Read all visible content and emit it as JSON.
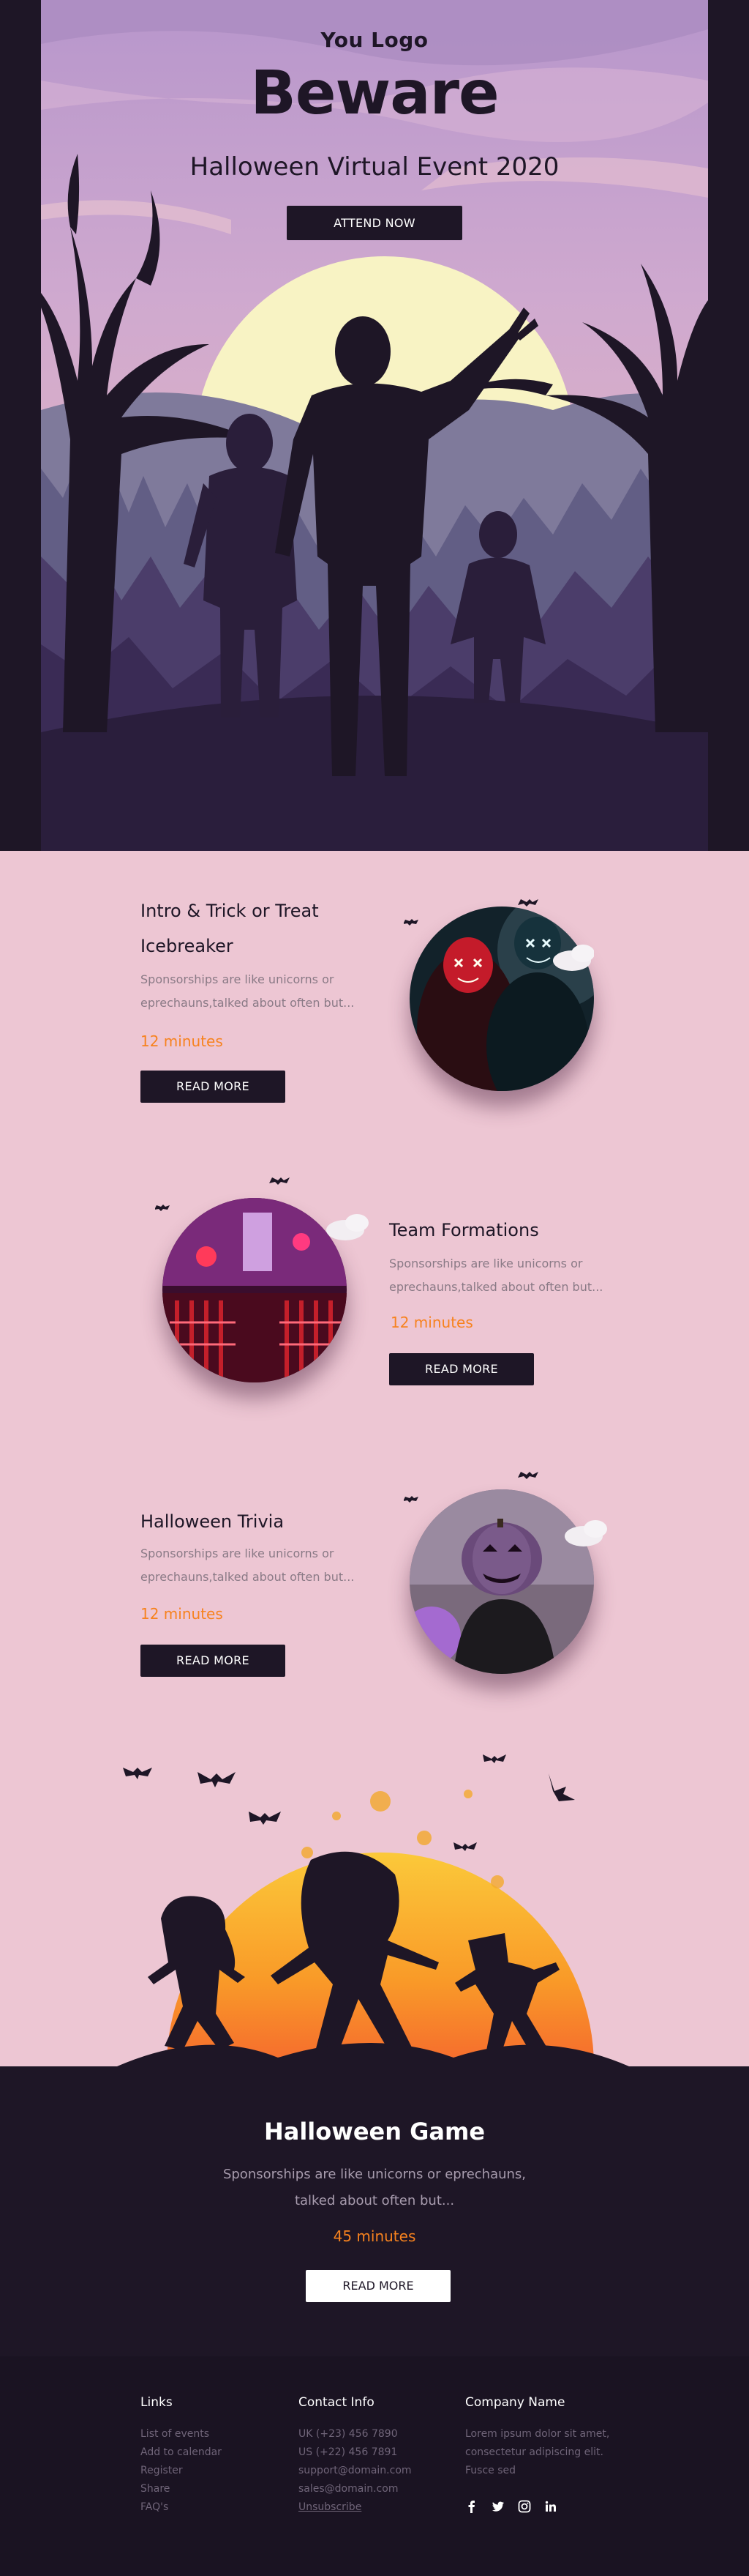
{
  "hero": {
    "logo": "You Logo",
    "title": "Beware",
    "subtitle": "Halloween Virtual Event 2020",
    "cta": "ATTEND NOW"
  },
  "sessions": [
    {
      "title_line1": "Intro & Trick or Treat",
      "title_line2": "Icebreaker",
      "desc_line1": "Sponsorships are like unicorns or",
      "desc_line2": "eprechauns,talked about often but...",
      "duration": "12 minutes",
      "cta": "READ MORE"
    },
    {
      "title_line1": "Team Formations",
      "desc_line1": "Sponsorships are like unicorns or",
      "desc_line2": "eprechauns,talked about often but...",
      "duration": "12 minutes",
      "cta": "READ MORE"
    },
    {
      "title_line1": "Halloween Trivia",
      "desc_line1": "Sponsorships are like unicorns or",
      "desc_line2": "eprechauns,talked about often but...",
      "duration": "12 minutes",
      "cta": "READ MORE"
    }
  ],
  "game": {
    "title": "Halloween Game",
    "desc_line1": "Sponsorships are like unicorns or eprechauns,",
    "desc_line2": "talked about often but...",
    "duration": "45 minutes",
    "cta": "READ MORE"
  },
  "footer": {
    "links": {
      "heading": "Links",
      "items": [
        "List of events",
        "Add to calendar",
        "Register",
        "Share",
        "FAQ's"
      ]
    },
    "contact": {
      "heading": "Contact Info",
      "items": [
        "UK (+23) 456 7890",
        "US (+22) 456 7891",
        "support@domain.com",
        "sales@domain.com",
        "Unsubscribe"
      ]
    },
    "company": {
      "heading": "Company Name",
      "lines": [
        "Lorem ipsum dolor sit amet,",
        "consectetur adipiscing elit.",
        "Fusce sed"
      ]
    },
    "social_icons": [
      "facebook-icon",
      "twitter-icon",
      "instagram-icon",
      "linkedin-icon"
    ]
  },
  "colors": {
    "dark": "#1e1626",
    "pink": "#edc6d3",
    "accent_orange": "#f7821e",
    "hero_sky": "#c7a6d6",
    "moon": "#f8f3c4"
  }
}
